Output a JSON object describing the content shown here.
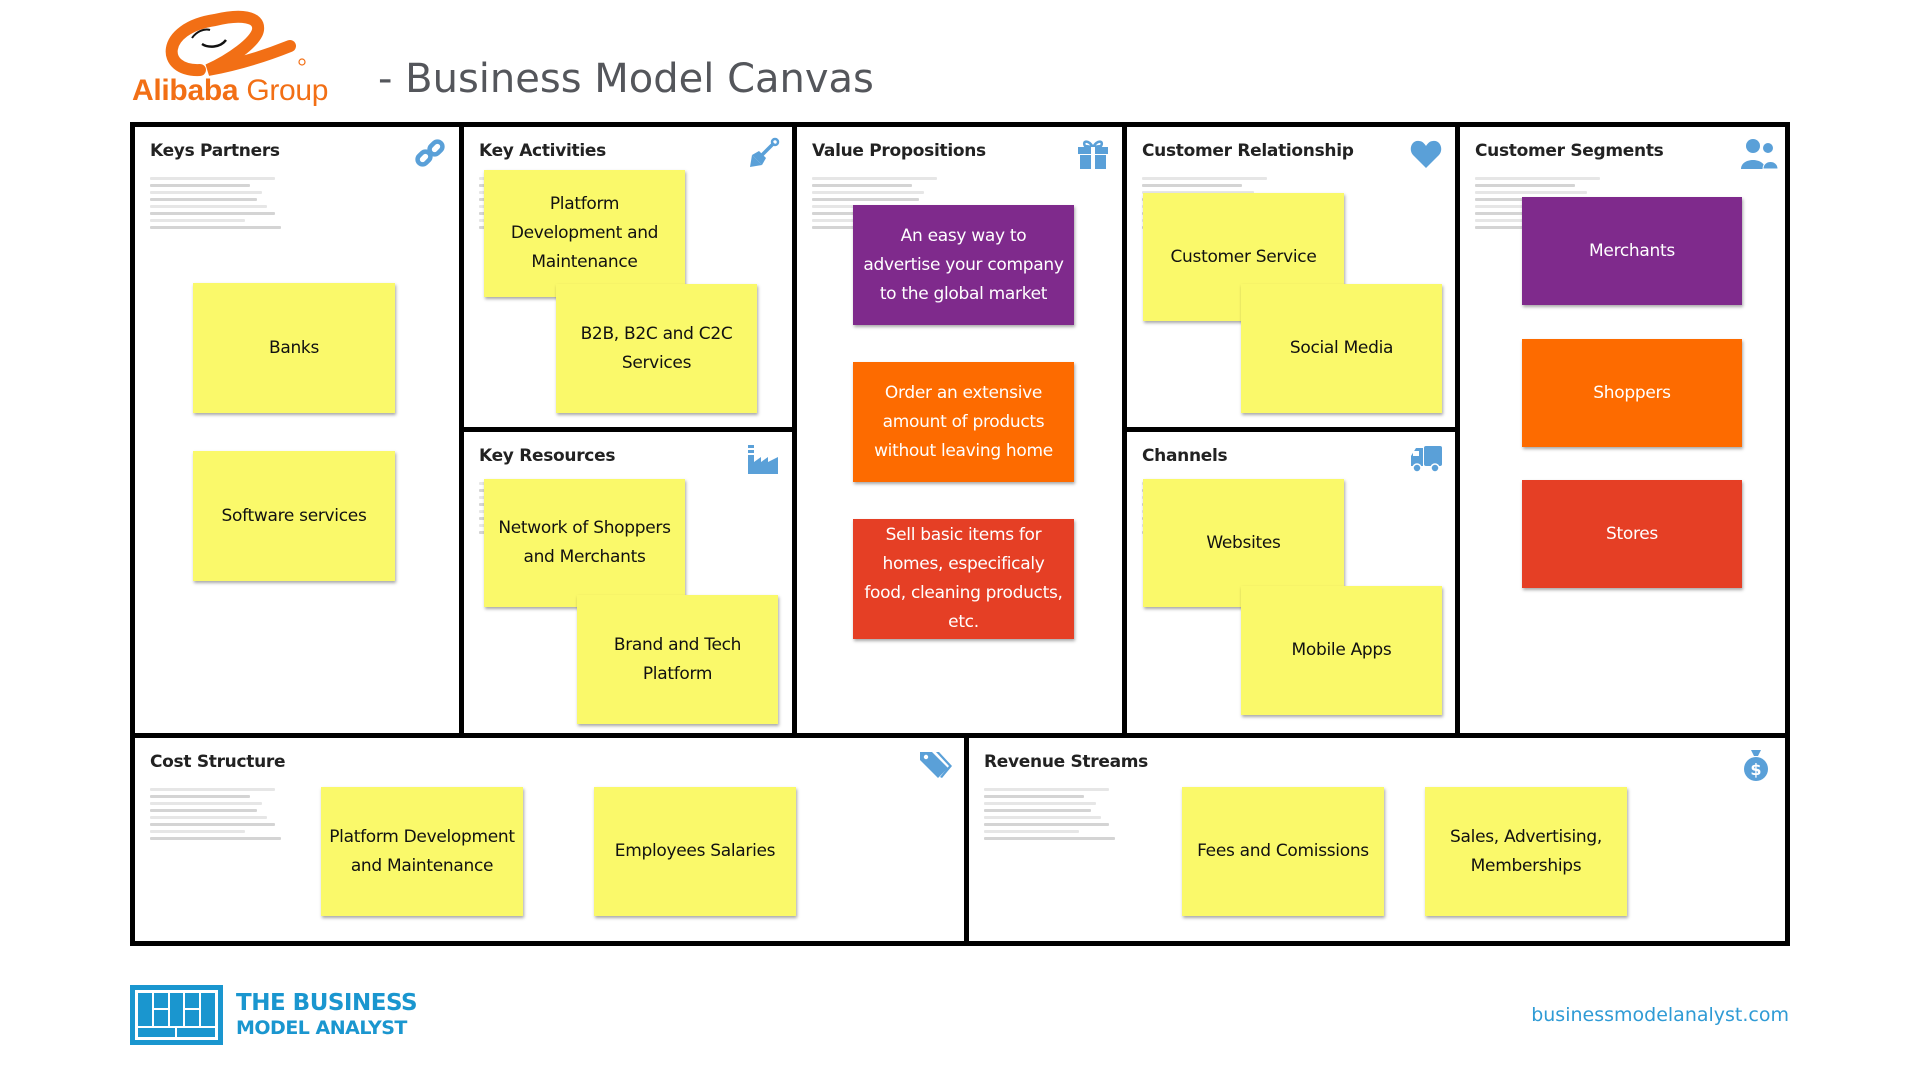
{
  "header": {
    "logo_word_bold": "Alibaba",
    "logo_word_light": "Group",
    "title": "- Business Model Canvas",
    "brand_color": "#f26f15"
  },
  "colors": {
    "icon": "#5aa0d8",
    "sticky_yellow": "#faf96a",
    "sticky_purple": "#7f2a8c",
    "sticky_orange": "#fd6b00",
    "sticky_red": "#e53f25"
  },
  "canvas": {
    "key_partners": {
      "title": "Keys Partners",
      "icon": "link-icon",
      "notes": [
        {
          "text": "Banks",
          "color": "yellow"
        },
        {
          "text": "Software services",
          "color": "yellow"
        }
      ]
    },
    "key_activities": {
      "title": "Key Activities",
      "icon": "shovel-icon",
      "notes": [
        {
          "text": "Platform Development and Maintenance",
          "color": "yellow"
        },
        {
          "text": "B2B, B2C and C2C Services",
          "color": "yellow"
        }
      ]
    },
    "key_resources": {
      "title": "Key Resources",
      "icon": "factory-icon",
      "notes": [
        {
          "text": "Network of Shoppers and Merchants",
          "color": "yellow"
        },
        {
          "text": "Brand and Tech Platform",
          "color": "yellow"
        }
      ]
    },
    "value_propositions": {
      "title": "Value Propositions",
      "icon": "gift-icon",
      "notes": [
        {
          "text": "An easy way to advertise your company to the global market",
          "color": "purple"
        },
        {
          "text": "Order an extensive amount of products without leaving home",
          "color": "orange"
        },
        {
          "text": "Sell basic items for homes, especificaly food, cleaning products, etc.",
          "color": "red"
        }
      ]
    },
    "customer_relationship": {
      "title": "Customer Relationship",
      "icon": "heart-icon",
      "notes": [
        {
          "text": "Customer Service",
          "color": "yellow"
        },
        {
          "text": "Social Media",
          "color": "yellow"
        }
      ]
    },
    "channels": {
      "title": "Channels",
      "icon": "truck-icon",
      "notes": [
        {
          "text": "Websites",
          "color": "yellow"
        },
        {
          "text": "Mobile Apps",
          "color": "yellow"
        }
      ]
    },
    "customer_segments": {
      "title": "Customer Segments",
      "icon": "users-icon",
      "notes": [
        {
          "text": "Merchants",
          "color": "purple"
        },
        {
          "text": "Shoppers",
          "color": "orange"
        },
        {
          "text": "Stores",
          "color": "red"
        }
      ]
    },
    "cost_structure": {
      "title": "Cost Structure",
      "icon": "tags-icon",
      "notes": [
        {
          "text": "Platform Development and Maintenance",
          "color": "yellow"
        },
        {
          "text": "Employees Salaries",
          "color": "yellow"
        }
      ]
    },
    "revenue_streams": {
      "title": "Revenue Streams",
      "icon": "money-bag-icon",
      "notes": [
        {
          "text": "Fees and Comissions",
          "color": "yellow"
        },
        {
          "text": "Sales, Advertising, Memberships",
          "color": "yellow"
        }
      ]
    }
  },
  "footer": {
    "brand_line1": "THE BUSINESS",
    "brand_line2": "MODEL ANALYST",
    "url": "businessmodelanalyst.com",
    "brand_color": "#1a96cf"
  }
}
